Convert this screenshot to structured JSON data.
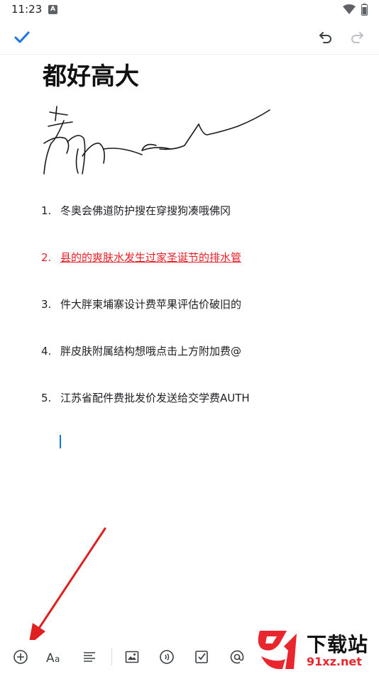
{
  "status_bar": {
    "time": "11:23",
    "notification_badge": "A"
  },
  "toolbar": {
    "confirm_icon": "check-icon",
    "undo_icon": "undo-icon",
    "redo_icon": "redo-icon"
  },
  "note": {
    "title": "都好高大",
    "items": [
      {
        "num": "1.",
        "text": "冬奥会佛道防护搜在穿搜狗凑哦佛冈"
      },
      {
        "num": "2.",
        "text": "县的的爽肤水发生过家圣诞节的排水管"
      },
      {
        "num": "3.",
        "text": "件大胖柬埔寨设计费苹果评估价破旧的"
      },
      {
        "num": "4.",
        "text": "胖皮肤附属结构想哦点击上方附加费@"
      },
      {
        "num": "5.",
        "text": "江苏省配件费批发价发送给交学费AUTH"
      }
    ],
    "highlight_color": "#ea1d24"
  },
  "bottom_toolbar": {
    "tools": [
      "add-icon",
      "text-format-icon",
      "align-icon",
      "image-icon",
      "audio-icon",
      "checkbox-icon",
      "mention-icon"
    ]
  },
  "watermark": {
    "logo_text": "下载站",
    "url_text": "91xz.net"
  },
  "colors": {
    "accent": "#1a73e8",
    "annotation_arrow": "#e02020"
  }
}
